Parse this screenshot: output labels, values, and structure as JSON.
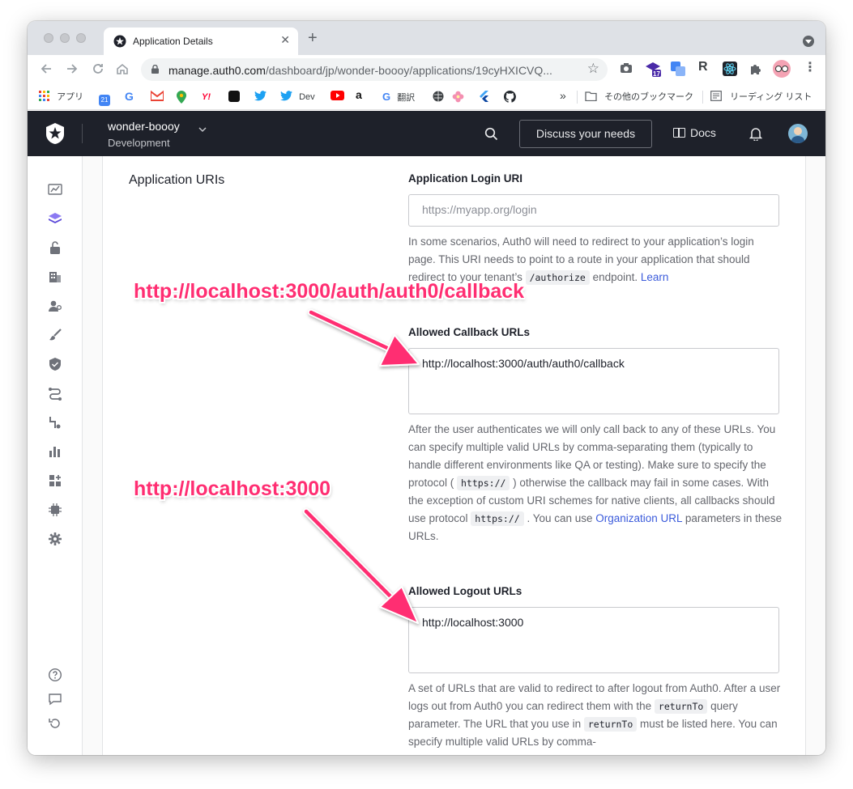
{
  "browser": {
    "tab_title": "Application Details",
    "tab_close": "✕",
    "new_tab": "+",
    "url_host": "manage.auth0.com",
    "url_path": "/dashboard/jp/wonder-boooy/applications/19cyHXICVQ...",
    "extension_badge": "17",
    "extension_r": "R"
  },
  "bookmarks": {
    "apps": "アプリ",
    "calendar_day": "21",
    "dev": "Dev",
    "translate": "翻訳",
    "more": "»",
    "other_bookmarks": "その他のブックマーク",
    "reading_list": "リーディング リスト"
  },
  "header": {
    "tenant_name": "wonder-boooy",
    "environment": "Development",
    "discuss_button": "Discuss your needs",
    "docs_link": "Docs"
  },
  "section": {
    "title": "Application URIs"
  },
  "login_uri": {
    "label": "Application Login URI",
    "placeholder": "https://myapp.org/login",
    "help_1": "In some scenarios, Auth0 will need to redirect to your application’s login page. This URI needs to point to a route in your application that should redirect to your tenant’s ",
    "help_code": "/authorize",
    "help_2": " endpoint. ",
    "help_link": "Learn"
  },
  "callback_urls": {
    "label": "Allowed Callback URLs",
    "value": "http://localhost:3000/auth/auth0/callback",
    "help_1": "After the user authenticates we will only call back to any of these URLs. You can specify multiple valid URLs by comma-separating them (typically to handle different environments like QA or testing). Make sure to specify the protocol ( ",
    "help_code_1": "https://",
    "help_2": " ) otherwise the callback may fail in some cases. With the exception of custom URI schemes for native clients, all callbacks should use protocol ",
    "help_code_2": "https://",
    "help_3": " . You can use ",
    "help_link": "Organization URL",
    "help_4": " parameters in these URLs."
  },
  "logout_urls": {
    "label": "Allowed Logout URLs",
    "value": "http://localhost:3000",
    "help_1": "A set of URLs that are valid to redirect to after logout from Auth0. After a user logs out from Auth0 you can redirect them with the ",
    "help_code_1": "returnTo",
    "help_2": " query parameter. The URL that you use in ",
    "help_code_2": "returnTo",
    "help_3": " must be listed here. You can specify multiple valid URLs by comma-"
  },
  "annotations": {
    "callback": "http://localhost:3000/auth/auth0/callback",
    "logout": "http://localhost:3000"
  },
  "colors": {
    "header_bg": "#1e212a",
    "annotation": "#ff2e72",
    "link": "#3b5bdb"
  }
}
